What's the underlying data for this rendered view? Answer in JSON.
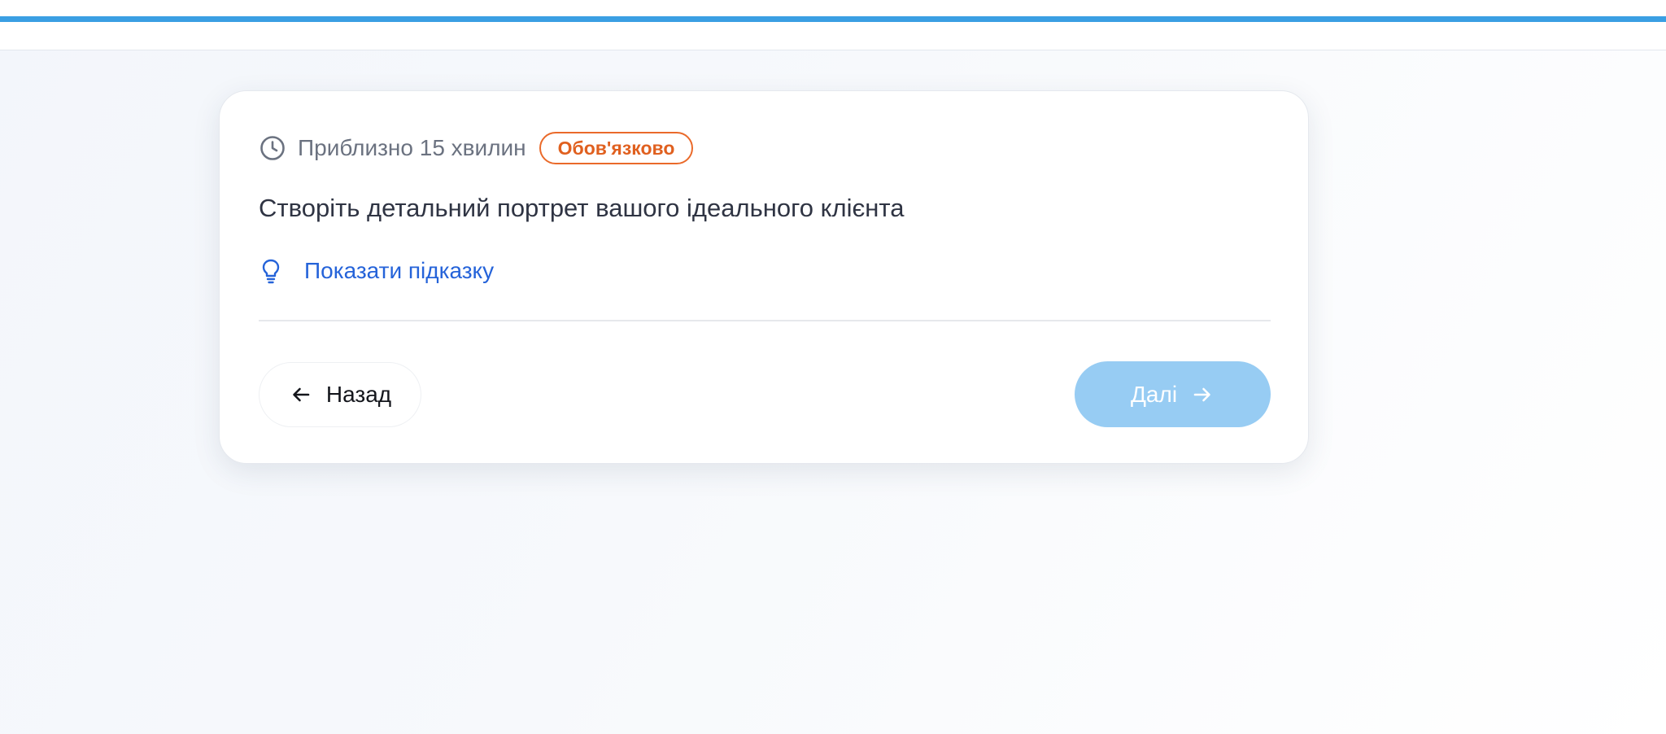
{
  "progress": {
    "fraction": 1.0,
    "color": "#3a9fe3"
  },
  "task": {
    "duration_icon": "clock-icon",
    "duration_text": "Приблизно 15 хвилин",
    "required_badge": "Обов'язково",
    "badge_color": "#e0601f",
    "question": "Створіть детальний портрет вашого ідеального клієнта",
    "hint_icon": "lightbulb-icon",
    "hint_label": "Показати підказку",
    "hint_color": "#2563d9"
  },
  "navigation": {
    "back_icon": "arrow-left-icon",
    "back_label": "Назад",
    "next_label": "Далі",
    "next_icon": "arrow-right-icon",
    "next_color": "#97ccf3"
  }
}
